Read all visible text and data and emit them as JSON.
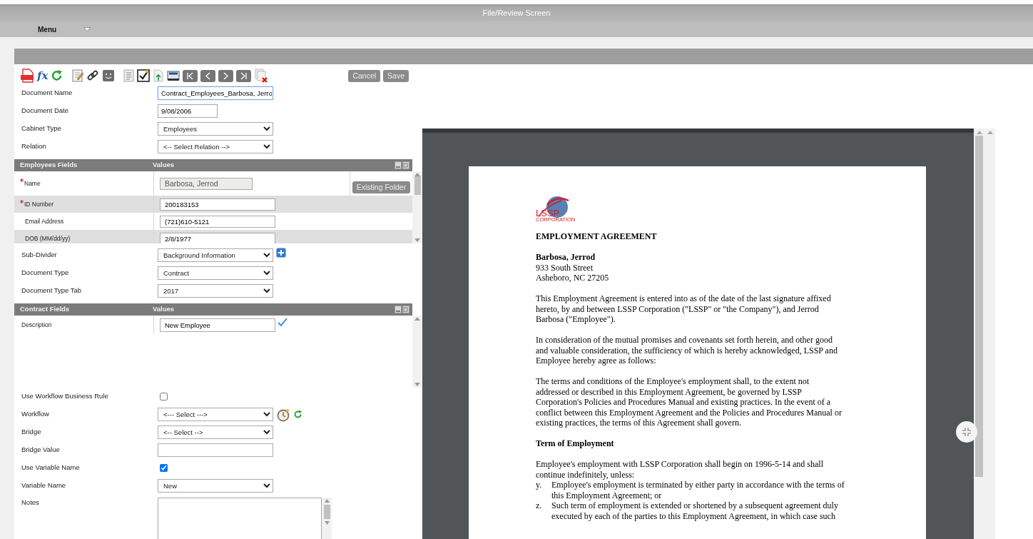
{
  "window": {
    "title": "File/Review Screen"
  },
  "menu": {
    "label": "Menu"
  },
  "toolbar": {
    "formula_label": "fx",
    "buttons": [
      {
        "label": "Cancel"
      },
      {
        "label": "Save"
      }
    ]
  },
  "document_fields": [
    {
      "label": "Document Name",
      "kind": "text",
      "value": "Contract_Employees_Barbosa, Jerro",
      "focused": true
    },
    {
      "label": "Document Date",
      "kind": "date",
      "value": "9/08/2006",
      "focused": false
    },
    {
      "label": "Cabinet Type",
      "kind": "select",
      "value": "Employees"
    },
    {
      "label": "Relation",
      "kind": "select",
      "value": "<-- Select Relation -->"
    }
  ],
  "employees_fields": {
    "columns": [
      "Employees Fields",
      "Values"
    ],
    "folder_button": "Existing Folder",
    "rows": [
      {
        "label": "Name",
        "required": true,
        "value": "Barbosa, Jerrod",
        "disabled": true
      },
      {
        "label": "ID Number",
        "required": true,
        "value": "200183153",
        "disabled": false
      },
      {
        "label": "Email Address",
        "required": false,
        "value": "(721)610-5121",
        "disabled": false
      },
      {
        "label": "DOB (MM/dd/yy)",
        "required": false,
        "value": "2/8/1977",
        "disabled": false
      }
    ]
  },
  "classification_fields": [
    {
      "label": "Sub-Divider",
      "kind": "select-add",
      "value": "Background Information"
    },
    {
      "label": "Document Type",
      "kind": "select",
      "value": "Contract"
    },
    {
      "label": "Document Type Tab",
      "kind": "select",
      "value": "2017"
    }
  ],
  "contract_fields": {
    "columns": [
      "Contract Fields",
      "Values"
    ],
    "rows": [
      {
        "label": "Description",
        "value": "New Employee",
        "validated": true
      }
    ]
  },
  "workflow_fields": [
    {
      "label": "Use Workflow Business Rule",
      "kind": "checkbox",
      "checked": false
    },
    {
      "label": "Workflow",
      "kind": "select-tools",
      "value": "<--- Select --->"
    },
    {
      "label": "Bridge",
      "kind": "select",
      "value": "<-- Select -->"
    },
    {
      "label": "Bridge Value",
      "kind": "text"
    },
    {
      "label": "Use Variable Name",
      "kind": "checkbox",
      "checked": true
    },
    {
      "label": "Variable Name",
      "kind": "select",
      "value": "New"
    },
    {
      "label": "Notes",
      "kind": "textarea"
    }
  ],
  "document": {
    "logo_text": "LSSP",
    "logo_subtext": "CORPORATION",
    "title": "EMPLOYMENT AGREEMENT",
    "recipient": "Barbosa, Jerrod",
    "address_lines": [
      "933 South Street",
      "Asheboro, NC 27205"
    ],
    "body": [
      {
        "kind": "paragraph",
        "lines": [
          "This Employment Agreement is entered into as of the date of the last signature affixed",
          "hereto, by and between LSSP Corporation (\"LSSP\" or \"the Company\"), and Jerrod",
          "Barbosa (\"Employee\")."
        ]
      },
      {
        "kind": "paragraph",
        "lines": [
          "In consideration of the mutual promises and covenants set forth herein, and other good",
          "and valuable consideration, the sufficiency of which is hereby acknowledged, LSSP and",
          "Employee hereby agree as follows:"
        ]
      },
      {
        "kind": "paragraph",
        "lines": [
          "The terms and conditions of the Employee's employment shall, to the extent not",
          "addressed or described in this Employment Agreement, be governed by LSSP",
          "Corporation's Policies and Procedures Manual and existing practices. In the event of a",
          "conflict between this Employment Agreement and the Policies and Procedures Manual or",
          "existing practices, the terms of this Agreement shall govern."
        ]
      },
      {
        "kind": "heading",
        "lines": [
          "Term of Employment"
        ]
      },
      {
        "kind": "lead",
        "lines": [
          "Employee's employment with LSSP Corporation shall begin on 1996-5-14 and shall",
          "continue indefinitely, unless:"
        ]
      },
      {
        "kind": "list_item",
        "marker": "y.",
        "lines": [
          "Employee's employment is terminated by either party in accordance with the terms of",
          "this Employment Agreement; or"
        ]
      },
      {
        "kind": "list_item",
        "marker": "z.",
        "lines": [
          "Such term of employment is extended or shortened by a subsequent agreement duly",
          "executed by each of the parties to this Employment Agreement, in which case such"
        ]
      }
    ]
  }
}
